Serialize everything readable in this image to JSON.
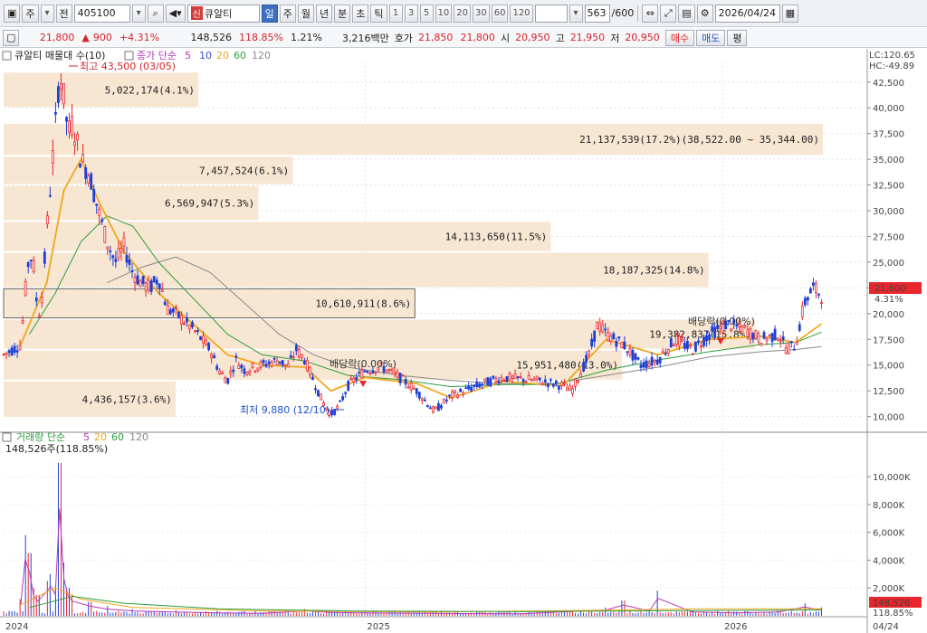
{
  "toolbar": {
    "period_label": "주",
    "prev_label": "전",
    "code": "405100",
    "new_badge": "신",
    "stock_name": "큐알티",
    "timeframes": [
      "일",
      "주",
      "월",
      "년",
      "분",
      "초",
      "틱"
    ],
    "active_timeframe": "일",
    "intervals": [
      "1",
      "3",
      "5",
      "10",
      "20",
      "30",
      "60",
      "120"
    ],
    "count": "563",
    "total": "/600",
    "date": "2026/04/24"
  },
  "quote": {
    "price": "21,800",
    "change_arrow": "▲",
    "change": "900",
    "change_pct": "+4.31%",
    "volume": "148,526",
    "volume_ratio": "118.85%",
    "turnover": "1.21%",
    "amount": "3,216백만",
    "ask_label": "호가",
    "ask": "21,850",
    "bid": "21,800",
    "open_label": "시",
    "open": "20,950",
    "high_label": "고",
    "high": "21,950",
    "low_label": "저",
    "low": "20,950",
    "buy_label": "매수",
    "sell_label": "매도",
    "eval_label": "평"
  },
  "legend": {
    "volume_profile": "큐알티 매물대 수(10)",
    "ma_label": "종가 단순",
    "ma_periods": [
      "5",
      "10",
      "20",
      "60",
      "120"
    ],
    "lc": "LC:120.65",
    "hc": "HC:-49.89",
    "volume_title": "거래량 단순",
    "volume_periods": [
      "5",
      "20",
      "60",
      "120"
    ],
    "volume_info": "148,526주(118.85%)"
  },
  "annotations": {
    "high": "최고 43,500 (03/05)",
    "low": "최저 9,880 (12/10)",
    "dividend1": "배당락(0.00%)",
    "dividend2": "배당락(0.00%)"
  },
  "price_tag": {
    "price": "21,800",
    "pct": "4.31%"
  },
  "volume_tag": {
    "volume": "148,526",
    "pct": "118.85%"
  },
  "colors": {
    "up": "#e8262b",
    "down": "#1e3fd8",
    "ma5": "#b53ab5",
    "ma10": "#3b54d6",
    "ma20": "#f0a81e",
    "ma60": "#2e9e3e",
    "ma120": "#8a8a8a",
    "profile": "#f6e6d2"
  },
  "chart_data": {
    "type": "candlestick",
    "y_ticks": [
      "42,500",
      "40,000",
      "37,500",
      "35,000",
      "32,500",
      "30,000",
      "27,500",
      "25,000",
      "22,500",
      "20,000",
      "17,500",
      "15,000",
      "12,500",
      "10,000"
    ],
    "x_ticks": [
      "2024",
      "2025",
      "2026",
      "04/24"
    ],
    "volume_ticks": [
      "10,000K",
      "8,000K",
      "6,000K",
      "4,000K",
      "2,000K"
    ],
    "ylim": [
      9000,
      44500
    ],
    "volume_profile": [
      {
        "label": "5,022,174(4.1%)",
        "low": 40000,
        "high": 43500,
        "value": 5022174
      },
      {
        "label": "21,137,539(17.2%)(38,522.00 ~ 35,344.00)",
        "low": 35344,
        "high": 38522,
        "value": 21137539
      },
      {
        "label": "7,457,524(6.1%)",
        "low": 32500,
        "high": 35344,
        "value": 7457524
      },
      {
        "label": "6,569,947(5.3%)",
        "low": 29000,
        "high": 32500,
        "value": 6569947
      },
      {
        "label": "14,113,650(11.5%)",
        "low": 26000,
        "high": 29000,
        "value": 14113650
      },
      {
        "label": "18,187,325(14.8%)",
        "low": 22500,
        "high": 26000,
        "value": 18187325
      },
      {
        "label": "10,610,911(8.6%)",
        "low": 19500,
        "high": 22500,
        "value": 10610911
      },
      {
        "label": "19,382,837(15.8%)",
        "low": 16500,
        "high": 19500,
        "value": 19382837
      },
      {
        "label": "15,951,480(13.0%)",
        "low": 13500,
        "high": 16500,
        "value": 15951480
      },
      {
        "label": "4,436,157(3.6%)",
        "low": 9880,
        "high": 13500,
        "value": 4436157
      }
    ],
    "price_path": [
      [
        0,
        16000
      ],
      [
        0.01,
        16500
      ],
      [
        0.02,
        17000
      ],
      [
        0.025,
        22000
      ],
      [
        0.03,
        26000
      ],
      [
        0.035,
        24500
      ],
      [
        0.04,
        19500
      ],
      [
        0.045,
        22000
      ],
      [
        0.05,
        28000
      ],
      [
        0.055,
        33000
      ],
      [
        0.06,
        38000
      ],
      [
        0.065,
        43500
      ],
      [
        0.07,
        41000
      ],
      [
        0.075,
        37500
      ],
      [
        0.08,
        38500
      ],
      [
        0.09,
        35000
      ],
      [
        0.1,
        33500
      ],
      [
        0.11,
        30000
      ],
      [
        0.12,
        27000
      ],
      [
        0.13,
        25000
      ],
      [
        0.14,
        26500
      ],
      [
        0.15,
        24000
      ],
      [
        0.16,
        23000
      ],
      [
        0.17,
        22500
      ],
      [
        0.18,
        23500
      ],
      [
        0.19,
        20500
      ],
      [
        0.2,
        20000
      ],
      [
        0.22,
        18500
      ],
      [
        0.24,
        16500
      ],
      [
        0.25,
        14500
      ],
      [
        0.26,
        13500
      ],
      [
        0.27,
        15500
      ],
      [
        0.28,
        14500
      ],
      [
        0.3,
        15000
      ],
      [
        0.32,
        15500
      ],
      [
        0.33,
        14800
      ],
      [
        0.34,
        16500
      ],
      [
        0.35,
        15500
      ],
      [
        0.36,
        13500
      ],
      [
        0.37,
        11500
      ],
      [
        0.38,
        10200
      ],
      [
        0.39,
        11000
      ],
      [
        0.4,
        13000
      ],
      [
        0.42,
        14500
      ],
      [
        0.44,
        14800
      ],
      [
        0.46,
        13800
      ],
      [
        0.48,
        12500
      ],
      [
        0.5,
        10500
      ],
      [
        0.52,
        12000
      ],
      [
        0.55,
        13000
      ],
      [
        0.58,
        13800
      ],
      [
        0.62,
        13500
      ],
      [
        0.65,
        13000
      ],
      [
        0.66,
        12500
      ],
      [
        0.68,
        16000
      ],
      [
        0.69,
        19000
      ],
      [
        0.7,
        18000
      ],
      [
        0.72,
        17000
      ],
      [
        0.74,
        15000
      ],
      [
        0.76,
        15500
      ],
      [
        0.78,
        17500
      ],
      [
        0.8,
        16500
      ],
      [
        0.82,
        18000
      ],
      [
        0.84,
        19000
      ],
      [
        0.86,
        18500
      ],
      [
        0.88,
        17500
      ],
      [
        0.9,
        18000
      ],
      [
        0.91,
        16500
      ],
      [
        0.92,
        17000
      ],
      [
        0.93,
        21000
      ],
      [
        0.94,
        22500
      ],
      [
        0.95,
        21800
      ]
    ],
    "ma_series": {
      "ma20": [
        [
          0.02,
          17000
        ],
        [
          0.05,
          23000
        ],
        [
          0.07,
          32000
        ],
        [
          0.09,
          35000
        ],
        [
          0.11,
          31000
        ],
        [
          0.14,
          26000
        ],
        [
          0.18,
          22000
        ],
        [
          0.22,
          19000
        ],
        [
          0.26,
          16000
        ],
        [
          0.3,
          15000
        ],
        [
          0.35,
          14800
        ],
        [
          0.38,
          12500
        ],
        [
          0.42,
          13800
        ],
        [
          0.48,
          13200
        ],
        [
          0.52,
          11800
        ],
        [
          0.58,
          13400
        ],
        [
          0.65,
          13000
        ],
        [
          0.7,
          17500
        ],
        [
          0.76,
          16000
        ],
        [
          0.82,
          17500
        ],
        [
          0.88,
          17800
        ],
        [
          0.92,
          17200
        ],
        [
          0.95,
          19000
        ]
      ],
      "ma60": [
        [
          0.03,
          18000
        ],
        [
          0.06,
          22000
        ],
        [
          0.09,
          27000
        ],
        [
          0.12,
          29500
        ],
        [
          0.15,
          28500
        ],
        [
          0.18,
          25000
        ],
        [
          0.22,
          21500
        ],
        [
          0.26,
          18000
        ],
        [
          0.3,
          16000
        ],
        [
          0.35,
          15400
        ],
        [
          0.4,
          14000
        ],
        [
          0.46,
          13600
        ],
        [
          0.52,
          12900
        ],
        [
          0.58,
          13100
        ],
        [
          0.64,
          13100
        ],
        [
          0.7,
          14500
        ],
        [
          0.76,
          15500
        ],
        [
          0.82,
          16300
        ],
        [
          0.88,
          17000
        ],
        [
          0.92,
          17200
        ],
        [
          0.95,
          18200
        ]
      ],
      "ma120": [
        [
          0.12,
          23000
        ],
        [
          0.16,
          24500
        ],
        [
          0.2,
          25500
        ],
        [
          0.24,
          24000
        ],
        [
          0.28,
          21000
        ],
        [
          0.32,
          18000
        ],
        [
          0.36,
          16000
        ],
        [
          0.4,
          14800
        ],
        [
          0.46,
          14000
        ],
        [
          0.52,
          13500
        ],
        [
          0.58,
          13200
        ],
        [
          0.64,
          13200
        ],
        [
          0.7,
          14000
        ],
        [
          0.76,
          14800
        ],
        [
          0.82,
          15800
        ],
        [
          0.88,
          16300
        ],
        [
          0.92,
          16500
        ],
        [
          0.95,
          16800
        ]
      ]
    },
    "volume_bars": [
      [
        0.02,
        1200
      ],
      [
        0.025,
        5800
      ],
      [
        0.03,
        4500
      ],
      [
        0.035,
        2000
      ],
      [
        0.04,
        1500
      ],
      [
        0.05,
        2500
      ],
      [
        0.055,
        3000
      ],
      [
        0.06,
        2200
      ],
      [
        0.065,
        11000
      ],
      [
        0.07,
        3800
      ],
      [
        0.075,
        2000
      ],
      [
        0.08,
        1500
      ],
      [
        0.1,
        1000
      ],
      [
        0.12,
        700
      ],
      [
        0.15,
        500
      ],
      [
        0.2,
        400
      ],
      [
        0.25,
        300
      ],
      [
        0.3,
        250
      ],
      [
        0.35,
        500
      ],
      [
        0.38,
        350
      ],
      [
        0.42,
        300
      ],
      [
        0.5,
        250
      ],
      [
        0.6,
        200
      ],
      [
        0.7,
        600
      ],
      [
        0.72,
        1100
      ],
      [
        0.75,
        500
      ],
      [
        0.76,
        1800
      ],
      [
        0.8,
        400
      ],
      [
        0.85,
        300
      ],
      [
        0.9,
        400
      ],
      [
        0.93,
        900
      ],
      [
        0.95,
        600
      ]
    ]
  }
}
